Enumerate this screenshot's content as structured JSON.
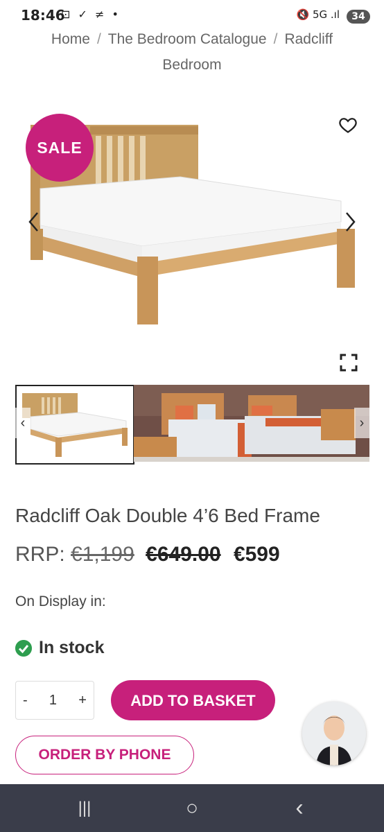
{
  "status": {
    "time": "18:46",
    "left_icons": "⊡ ✓ ≠ •",
    "right_icons": "🔇 5G .ıl",
    "battery": "34"
  },
  "breadcrumb": {
    "home": "Home",
    "catalogue": "The Bedroom Catalogue",
    "current_line1": "Radcliff",
    "current_line2": "Bedroom",
    "separator": "/"
  },
  "badge": {
    "sale": "SALE"
  },
  "product": {
    "title": "Radcliff Oak Double 4’6 Bed Frame",
    "rrp_label": "RRP:",
    "rrp_value": "€1,199",
    "was_price": "€649.00",
    "price": "€599",
    "display_label": "On Display in:",
    "stock": "In stock"
  },
  "quantity": {
    "minus": "-",
    "value": "1",
    "plus": "+"
  },
  "buttons": {
    "add_to_basket": "ADD TO BASKET",
    "order_by_phone": "ORDER BY PHONE"
  },
  "gallery": {
    "prev_arrow": "‹",
    "next_arrow": "›"
  },
  "colors": {
    "brand": "#c7207b",
    "stock_green": "#2e9e4f",
    "navbar": "#3a3d4a"
  },
  "icons": [
    "heart-icon",
    "chevron-left-icon",
    "chevron-right-icon",
    "expand-icon",
    "check-circle-icon",
    "recents-icon",
    "home-icon",
    "back-icon"
  ],
  "navbar": {
    "recents": "|||",
    "home": "○",
    "back": "‹"
  }
}
